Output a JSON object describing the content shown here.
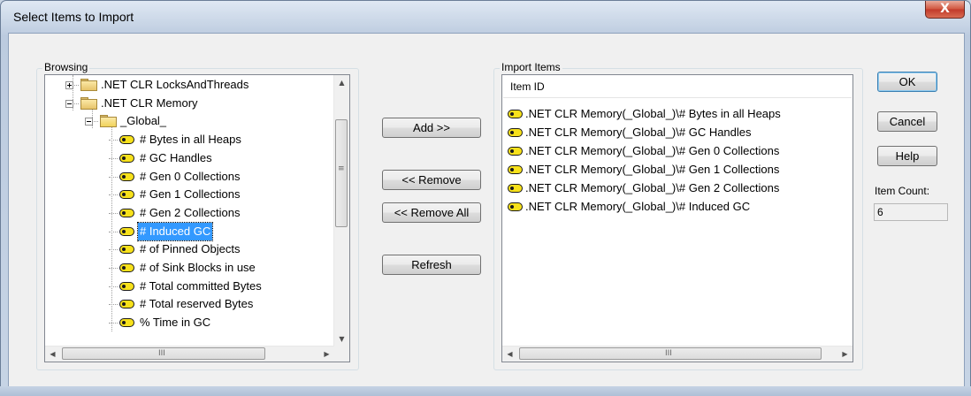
{
  "window": {
    "title": "Select Items to Import",
    "close_glyph": "X"
  },
  "browsing": {
    "label": "Browsing",
    "tree": [
      {
        "label": ".NET CLR LocksAndThreads",
        "kind": "folder",
        "expander": "plus"
      },
      {
        "label": ".NET CLR Memory",
        "kind": "folder",
        "expander": "minus"
      },
      {
        "label": "_Global_",
        "kind": "instance",
        "expander": "minus"
      },
      {
        "label": "# Bytes in all Heaps",
        "kind": "counter"
      },
      {
        "label": "# GC Handles",
        "kind": "counter"
      },
      {
        "label": "# Gen 0 Collections",
        "kind": "counter"
      },
      {
        "label": "# Gen 1 Collections",
        "kind": "counter"
      },
      {
        "label": "# Gen 2 Collections",
        "kind": "counter"
      },
      {
        "label": "# Induced GC",
        "kind": "counter",
        "selected": true
      },
      {
        "label": "# of Pinned Objects",
        "kind": "counter"
      },
      {
        "label": "# of Sink Blocks in use",
        "kind": "counter"
      },
      {
        "label": "# Total committed Bytes",
        "kind": "counter"
      },
      {
        "label": "# Total reserved Bytes",
        "kind": "counter"
      },
      {
        "label": "% Time in GC",
        "kind": "counter"
      }
    ],
    "hscroll_grip": "III",
    "vscroll_grip": "≡"
  },
  "buttons": {
    "add": "Add >>",
    "remove": "<< Remove",
    "remove_all": "<< Remove All",
    "refresh": "Refresh",
    "ok": "OK",
    "cancel": "Cancel",
    "help": "Help"
  },
  "import_items": {
    "label": "Import Items",
    "column_header": "Item ID",
    "rows": [
      ".NET CLR Memory(_Global_)\\# Bytes in all Heaps",
      ".NET CLR Memory(_Global_)\\# GC Handles",
      ".NET CLR Memory(_Global_)\\# Gen 0 Collections",
      ".NET CLR Memory(_Global_)\\# Gen 1 Collections",
      ".NET CLR Memory(_Global_)\\# Gen 2 Collections",
      ".NET CLR Memory(_Global_)\\# Induced GC"
    ],
    "hscroll_grip": "III"
  },
  "item_count": {
    "label": "Item Count:",
    "value": "6"
  },
  "icons": {
    "folder": "folder-icon",
    "counter": "counter-icon",
    "expand": "expand-icon",
    "collapse": "collapse-icon"
  },
  "colors": {
    "selection": "#3399ff",
    "counter_icon": "#f7e11b",
    "close_button": "#c1392a"
  }
}
